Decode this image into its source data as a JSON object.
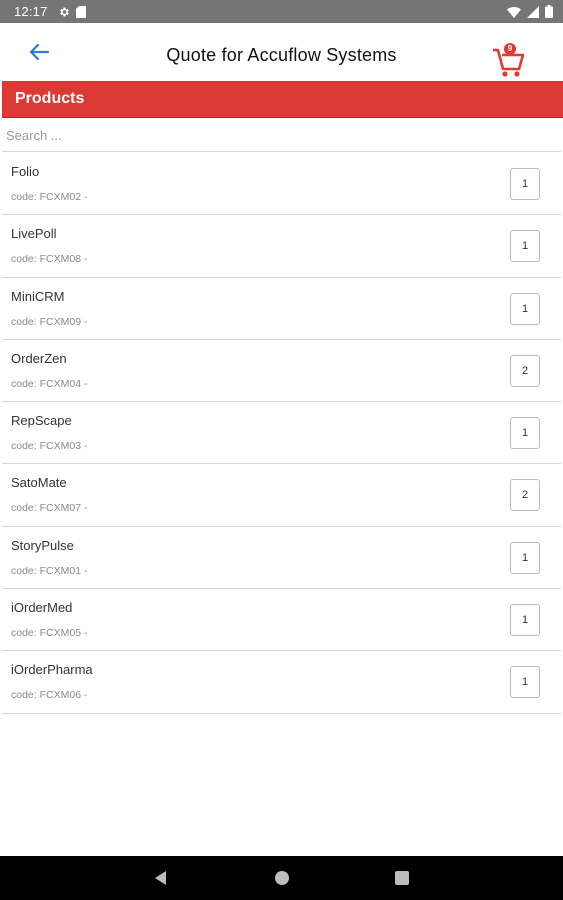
{
  "status_bar": {
    "time": "12:17",
    "icons": [
      "settings-icon",
      "sd-card-icon",
      "wifi-icon",
      "signal-icon",
      "battery-icon"
    ]
  },
  "app_bar": {
    "title": "Quote for Accuflow Systems",
    "back_icon": "arrow-back-icon",
    "cart_icon": "shopping-cart-icon",
    "cart_badge": "9",
    "accent_color": "#db3a34"
  },
  "section": {
    "title": "Products"
  },
  "search": {
    "placeholder": "Search ...",
    "value": ""
  },
  "products": [
    {
      "name": "Folio",
      "code": "code: FCXM02 -",
      "qty": "1"
    },
    {
      "name": "LivePoll",
      "code": "code: FCXM08 -",
      "qty": "1"
    },
    {
      "name": "MiniCRM",
      "code": "code: FCXM09 -",
      "qty": "1"
    },
    {
      "name": "OrderZen",
      "code": "code: FCXM04 -",
      "qty": "2"
    },
    {
      "name": "RepScape",
      "code": "code: FCXM03 -",
      "qty": "1"
    },
    {
      "name": "SatoMate",
      "code": "code: FCXM07 -",
      "qty": "2"
    },
    {
      "name": "StoryPulse",
      "code": "code: FCXM01 -",
      "qty": "1"
    },
    {
      "name": "iOrderMed",
      "code": "code: FCXM05 -",
      "qty": "1"
    },
    {
      "name": "iOrderPharma",
      "code": "code: FCXM06 -",
      "qty": "1"
    }
  ],
  "nav_bar": {
    "icons": [
      "nav-back-icon",
      "nav-home-icon",
      "nav-recents-icon"
    ]
  }
}
